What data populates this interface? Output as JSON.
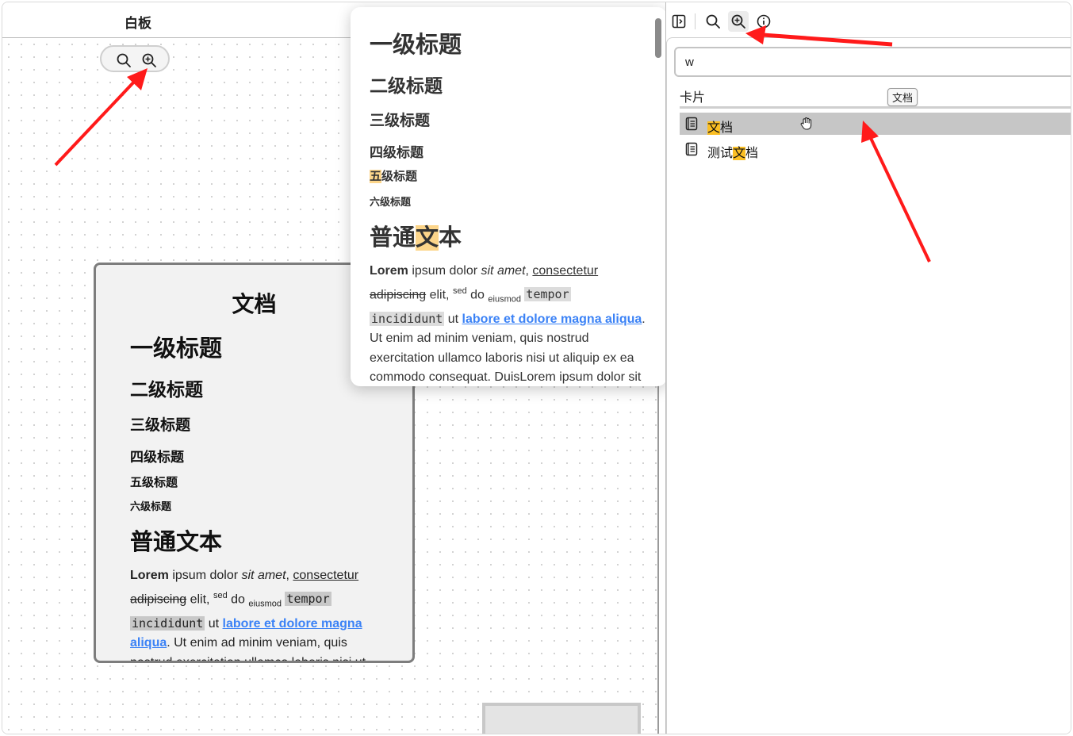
{
  "header": {
    "title": "白板"
  },
  "canvas": {
    "doc_card": {
      "title": "文档",
      "h1": "一级标题",
      "h2": "二级标题",
      "h3": "三级标题",
      "h4": "四级标题",
      "h5": "五级标题",
      "h6": "六级标题",
      "big": "普通文本",
      "body": {
        "lorem": "Lorem",
        "p1": " ipsum dolor ",
        "sit_amet": "sit amet",
        "comma": ", ",
        "consectetur": "consectetur",
        "adipiscing": "adipiscing",
        "elit": " elit, ",
        "sed": "sed",
        "do": " do ",
        "eiusmod": "eiusmod",
        "tempor": "tempor ",
        "incididunt": "incididunt",
        "ut": " ut ",
        "link": "labore et dolore magna ",
        "link2": "aliqua",
        "rest": ". Ut enim ad minim veniam, quis nostrud exercitation ullamco laboris nisi ut"
      }
    }
  },
  "popup": {
    "h1": "一级标题",
    "h2": "二级标题",
    "h3": "三级标题",
    "h4": "四级标题",
    "h5_hl": "五",
    "h5_rest": "级标题",
    "h6": "六级标题",
    "big_a": "普通",
    "big_hl": "文",
    "big_b": "本",
    "body": {
      "lorem": "Lorem",
      "p1": " ipsum dolor ",
      "sit_amet": "sit amet",
      "comma": ", ",
      "consectetur": "consectetur",
      "adipiscing": "adipiscing",
      "elit": " elit, ",
      "sed": "sed",
      "do": " do ",
      "eiusmod": "eiusmod",
      "tempor": "tempor ",
      "incididunt": "incididunt",
      "ut": " ut ",
      "link": "labore et dolore magna ",
      "link2": "aliqua",
      "rest": ". Ut enim ad minim veniam, quis nostrud exercitation ullamco laboris nisi ut aliquip ex ea commodo consequat. DuisLorem ipsum dolor sit amet, consectetur adipiscing elit, sed do"
    }
  },
  "sidebar": {
    "search": {
      "value": "w"
    },
    "section_label": "卡片",
    "tooltip": "文档",
    "results": [
      {
        "prefix": "",
        "match": "文",
        "suffix": "档"
      },
      {
        "prefix": "测试",
        "match": "文",
        "suffix": "档"
      }
    ]
  },
  "icons": [
    "sidebar-toggle-icon",
    "zoom-out-icon",
    "zoom-in-icon",
    "info-icon",
    "document-icon",
    "hand-cursor-icon"
  ],
  "colors": {
    "highlight": "#fbbf24",
    "soft_highlight": "#fcd58a",
    "link": "#3b82f6",
    "arrow": "#ff1a1a"
  }
}
